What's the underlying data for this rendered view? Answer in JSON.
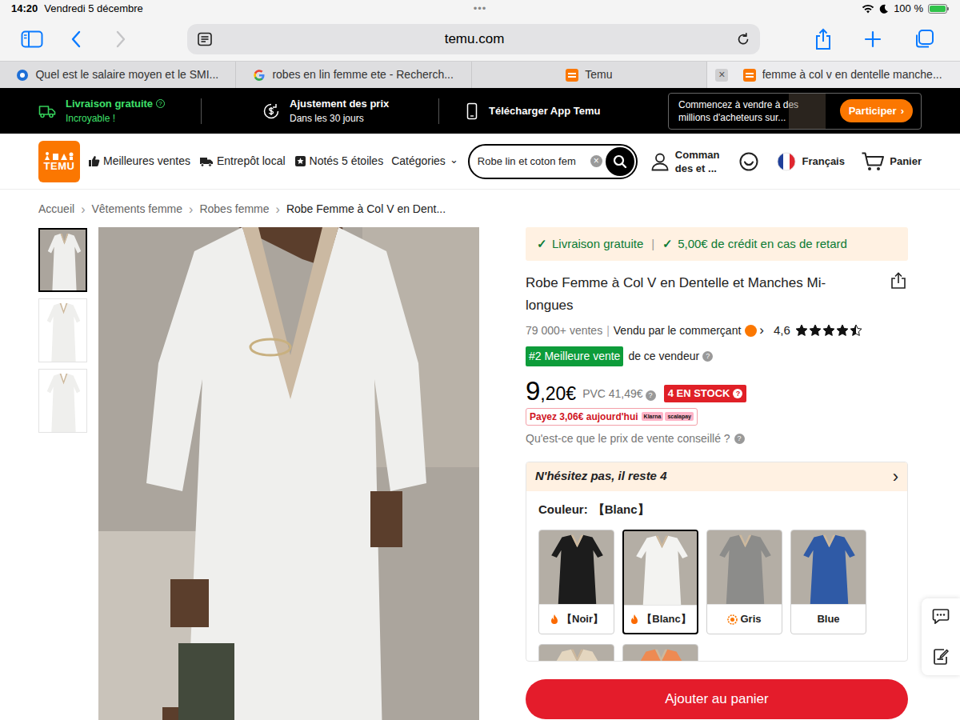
{
  "status_bar": {
    "time": "14:20",
    "date": "Vendredi 5 décembre",
    "dots": "•••",
    "battery": "100 %",
    "battery_level": 1,
    "charging": true
  },
  "help": "?",
  "browser": {
    "url": "temu.com",
    "tab_close": "×",
    "tabs": [
      {
        "label": "Quel est le salaire moyen et le SMI...",
        "selected": false,
        "kind": "site"
      },
      {
        "label": "robes en lin femme ete - Recherch...",
        "selected": false,
        "kind": "google"
      },
      {
        "label": "Temu",
        "selected": false,
        "kind": "temu"
      },
      {
        "label": "femme à col v en dentelle manche...",
        "selected": true,
        "kind": "temu"
      }
    ]
  },
  "banner": {
    "shipping": {
      "title": "Livraison gratuite",
      "subtitle": "Incroyable !"
    },
    "price": {
      "title": "Ajustement des prix",
      "subtitle": "Dans les 30 jours"
    },
    "app": {
      "title": "Télécharger App Temu"
    },
    "seller": {
      "text": "Commencez à vendre à des millions d'acheteurs sur...",
      "button": "Participer",
      "button_icon": "›"
    }
  },
  "nav": {
    "logo": "TEMU",
    "links": [
      "Meilleures ventes",
      "Entrepôt local",
      "Notés 5 étoiles"
    ],
    "categories": "Catégories",
    "categories_icon": "⌄",
    "search": {
      "value": "Robe lin et coton fem",
      "clear": "×"
    },
    "orders": [
      "Comman",
      "des et ..."
    ],
    "language": "Français",
    "cart": "Panier"
  },
  "breadcrumb": {
    "separator": "›",
    "items": [
      "Accueil",
      "Vêtements femme",
      "Robes femme",
      "Robe Femme à Col V en Dent..."
    ]
  },
  "gallery": {
    "thumbnails": [
      {
        "selected": true
      },
      {
        "selected": false
      },
      {
        "selected": false
      }
    ]
  },
  "product": {
    "perks": [
      {
        "check": "✓",
        "label": "Livraison gratuite"
      },
      {
        "check": "✓",
        "label": "5,00€ de crédit en cas de retard"
      }
    ],
    "perk_separator": "|",
    "title": "Robe Femme à Col V en Dentelle et Manches Mi-longues",
    "sales": "79 000+ ventes",
    "sales_separator": "|",
    "seller": "Vendu par le commerçant",
    "seller_arrow": "›",
    "rating": "4,6",
    "stars": 4.5,
    "rank_badge": "#2 Meilleure vente",
    "rank_text": "de ce vendeur",
    "price": {
      "main": "9",
      "rest": ",20€"
    },
    "rrp": "PVC 41,49€",
    "stock": "4 EN STOCK",
    "pay_today": "Payez 3,06€ aujourd'hui",
    "pay_brands": [
      "Klarna",
      "scalapay"
    ],
    "rrp_question": "Qu'est-ce que le prix de vente conseillé ?",
    "urgency": "N'hésitez pas, il reste 4",
    "urgency_arrow": "›",
    "color_label": "Couleur:",
    "color_value": "【Blanc】",
    "colors": [
      {
        "label": "【Noir】",
        "selected": false,
        "kind": "hot",
        "color": "#1c1c1c"
      },
      {
        "label": "【Blanc】",
        "selected": true,
        "kind": "hot",
        "color": "#f3f3f1"
      },
      {
        "label": "Gris",
        "selected": false,
        "kind": "trend",
        "color": "#8c8c8a"
      },
      {
        "label": "Blue",
        "selected": false,
        "kind": "plain",
        "color": "#2f5aa6"
      }
    ],
    "more_colors": [
      {
        "color": "#e4d6bf"
      },
      {
        "color": "#ee8a52"
      }
    ],
    "add_to_cart": "Ajouter au panier"
  },
  "side_tools": [
    {
      "kind": "chat"
    },
    {
      "kind": "edit"
    }
  ]
}
